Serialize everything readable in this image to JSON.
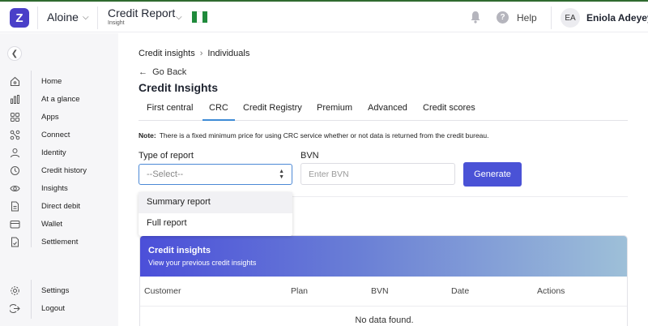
{
  "header": {
    "logo_letter": "Z",
    "org_name": "Aloine",
    "product_title": "Credit Report",
    "product_subtitle": "Insight",
    "flag_colors": [
      "#1f8a3b",
      "#ffffff",
      "#1f8a3b"
    ],
    "help_label": "Help",
    "avatar_initials": "EA",
    "user_name": "Eniola Adeyeye"
  },
  "sidebar": {
    "items": [
      {
        "label": "Home",
        "icon": "home-icon"
      },
      {
        "label": "At a glance",
        "icon": "bar-chart-icon"
      },
      {
        "label": "Apps",
        "icon": "apps-icon"
      },
      {
        "label": "Connect",
        "icon": "connect-icon"
      },
      {
        "label": "Identity",
        "icon": "user-icon"
      },
      {
        "label": "Credit history",
        "icon": "history-icon"
      },
      {
        "label": "Insights",
        "icon": "eye-icon"
      },
      {
        "label": "Direct debit",
        "icon": "document-icon"
      },
      {
        "label": "Wallet",
        "icon": "wallet-icon"
      },
      {
        "label": "Settlement",
        "icon": "settlement-icon"
      }
    ],
    "bottom_items": [
      {
        "label": "Settings",
        "icon": "gear-icon"
      },
      {
        "label": "Logout",
        "icon": "logout-icon"
      }
    ]
  },
  "main": {
    "breadcrumb": [
      "Credit insights",
      "Individuals"
    ],
    "go_back": "Go Back",
    "title": "Credit Insights",
    "tabs": [
      "First central",
      "CRC",
      "Credit Registry",
      "Premium",
      "Advanced",
      "Credit scores"
    ],
    "active_tab": "CRC",
    "note_label": "Note:",
    "note_text": "There is a fixed minimum price for using CRC service whether or not data is returned from the credit bureau.",
    "report_type_label": "Type of report",
    "report_type_value": "--Select--",
    "report_type_options": [
      "Summary report",
      "Full report"
    ],
    "bvn_label": "BVN",
    "bvn_placeholder": "Enter BVN",
    "generate_label": "Generate",
    "card": {
      "title": "Credit insights",
      "subtitle": "View your previous credit insights",
      "columns": [
        "Customer",
        "Plan",
        "BVN",
        "Date",
        "Actions"
      ],
      "empty_text": "No data found."
    }
  },
  "colors": {
    "brand": "#4a3fc8",
    "primary_button": "#4a52d6",
    "active_tab_underline": "#3e8bd6"
  }
}
